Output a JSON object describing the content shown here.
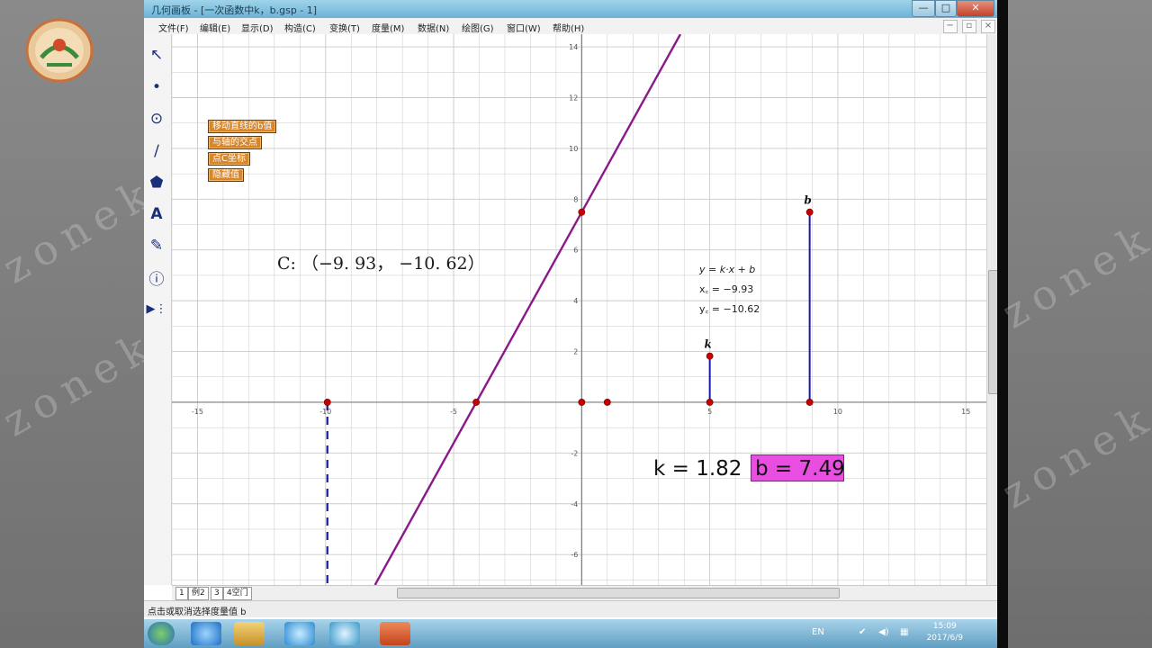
{
  "window": {
    "title": "几何画板 - [一次函数中k，b.gsp - 1]",
    "controls": [
      "—",
      "□",
      "✕"
    ]
  },
  "menu": [
    "文件(F)",
    "编辑(E)",
    "显示(D)",
    "构造(C)",
    "变换(T)",
    "度量(M)",
    "数据(N)",
    "绘图(G)",
    "窗口(W)",
    "帮助(H)"
  ],
  "mdi_controls": [
    "−",
    "▫",
    "×"
  ],
  "toolbox": [
    {
      "icon": "arrow-select-icon",
      "glyph": "↖"
    },
    {
      "icon": "point-tool-icon",
      "glyph": "•"
    },
    {
      "icon": "compass-tool-icon",
      "glyph": "⊙"
    },
    {
      "icon": "straightedge-tool-icon",
      "glyph": "∕"
    },
    {
      "icon": "polygon-tool-icon",
      "glyph": "⬟"
    },
    {
      "icon": "text-tool-icon",
      "glyph": "A"
    },
    {
      "icon": "marker-tool-icon",
      "glyph": "✎"
    },
    {
      "icon": "information-tool-icon",
      "glyph": "ⓘ"
    },
    {
      "icon": "custom-tool-icon",
      "glyph": "▶⋮"
    }
  ],
  "action_buttons": [
    "移动直线的b值",
    "与轴的交点",
    "点C坐标",
    "隐藏值"
  ],
  "coordinate_readout": "C: （−9. 93， −10. 62）",
  "function_info": {
    "equation": "y = k·x + b",
    "xc": "x꜀ = −9.93",
    "yc": "y꜀ = −10.62"
  },
  "parameters": {
    "k_text": "k = 1.82",
    "b_text": "b = 7.49",
    "k_label": "k",
    "b_label": "b",
    "b_highlight_color": "#e84fe0"
  },
  "chart_data": {
    "type": "line",
    "title": "",
    "xlabel": "",
    "ylabel": "",
    "x_ticks": [
      -15,
      -10,
      -5,
      0,
      5,
      10,
      15
    ],
    "y_ticks": [
      -8,
      -6,
      -4,
      -2,
      0,
      2,
      4,
      6,
      8,
      10,
      12,
      14
    ],
    "x_tick_labels": [
      "-15",
      "-10",
      "-5",
      "",
      "5",
      "10",
      "15"
    ],
    "y_tick_labels": [
      "14",
      "12",
      "10",
      "8",
      "6",
      "4",
      "2",
      "-2",
      "-4",
      "-6",
      "-8"
    ],
    "xlim": [
      -16.0,
      15.8
    ],
    "ylim": [
      -7.2,
      14.5
    ],
    "grid": true,
    "series": [
      {
        "kind": "line",
        "slope": 1.82,
        "intercept": 7.49,
        "color": "#8a1a8a"
      }
    ],
    "points": [
      {
        "x": 0,
        "y": 7.49
      },
      {
        "x": -4.12,
        "y": 0
      },
      {
        "x": 0,
        "y": 0
      },
      {
        "x": 1,
        "y": 0
      },
      {
        "x": -9.93,
        "y": 0
      },
      {
        "x": 5,
        "y": 0
      },
      {
        "x": 5,
        "y": 1.82
      },
      {
        "x": 8.9,
        "y": 0
      },
      {
        "x": 8.9,
        "y": 7.49
      }
    ],
    "k_segment": {
      "x": 5,
      "y_from": 0,
      "y_to": 1.82
    },
    "b_segment": {
      "x": 8.9,
      "y_from": 0,
      "y_to": 7.49
    },
    "dashed_segment": {
      "x": -9.93,
      "y_from": 0,
      "y_to": -7.2
    },
    "colors": {
      "grid": "#c9c9c9",
      "axis": "#7a7a7a",
      "point": "#c80000",
      "segment": "#1a1aa8"
    }
  },
  "page_tabs": [
    "1",
    "例2",
    "3",
    "4空门"
  ],
  "status_text": "点击或取消选择度量值 b",
  "taskbar": {
    "icons": [
      "start-orb-icon",
      "ie-icon",
      "folder-icon",
      "sketchpad-icon",
      "media-icon",
      "powerpoint-icon"
    ],
    "tray": [
      "EN",
      "✔",
      "◀)",
      "▦"
    ],
    "time": "15:09",
    "date": "2017/6/9"
  },
  "watermark": "zonekey"
}
